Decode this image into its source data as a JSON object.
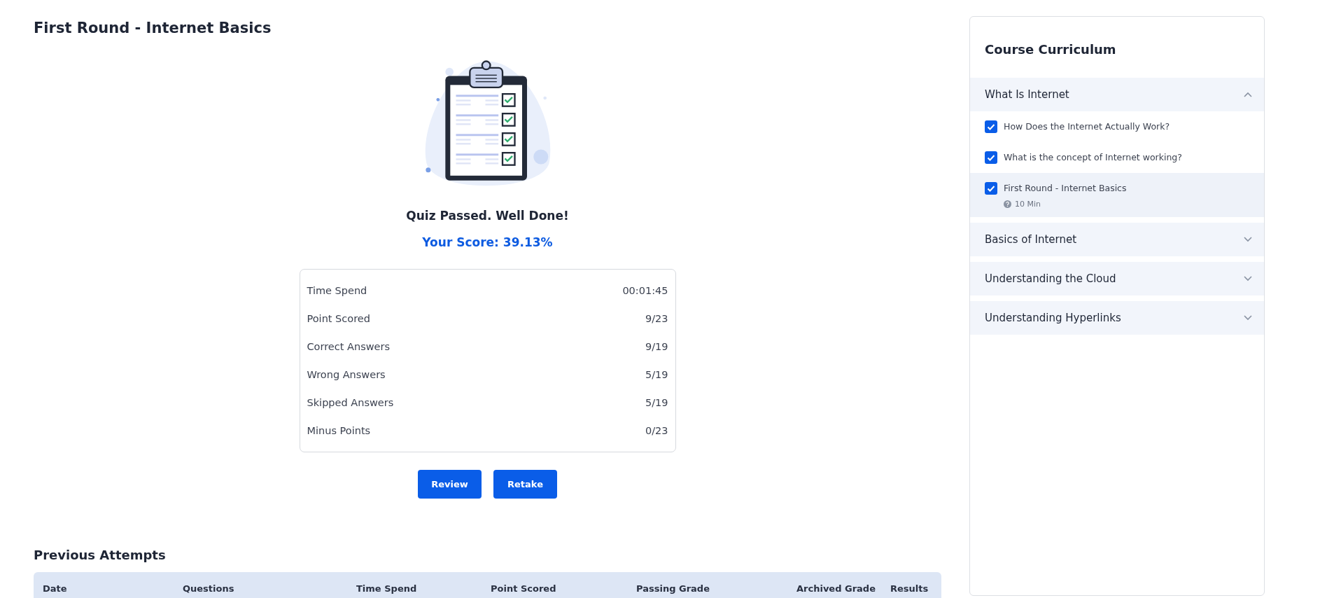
{
  "page_title": "First Round - Internet Basics",
  "result": {
    "message": "Quiz Passed. Well Done!",
    "score": "Your Score: 39.13%"
  },
  "stats": [
    {
      "label": "Time Spend",
      "value": "00:01:45"
    },
    {
      "label": "Point Scored",
      "value": "9/23"
    },
    {
      "label": "Correct Answers",
      "value": "9/19"
    },
    {
      "label": "Wrong Answers",
      "value": "5/19"
    },
    {
      "label": "Skipped Answers",
      "value": "5/19"
    },
    {
      "label": "Minus Points",
      "value": "0/23"
    }
  ],
  "buttons": [
    "Review",
    "Retake"
  ],
  "previous_attempts": {
    "title": "Previous Attempts",
    "columns": [
      "Date",
      "Questions",
      "Time Spend",
      "Point Scored",
      "Passing Grade",
      "Archived Grade",
      "Results"
    ]
  },
  "curriculum": {
    "title": "Course Curriculum",
    "sections": [
      {
        "title": "What Is Internet",
        "expanded": true,
        "lessons": [
          {
            "title": "How Does the Internet Actually Work?",
            "checked": true,
            "selected": false
          },
          {
            "title": "What is the concept of Internet working?",
            "checked": true,
            "selected": false
          },
          {
            "title": "First Round - Internet Basics",
            "checked": true,
            "selected": true,
            "duration": "10 Min"
          }
        ]
      },
      {
        "title": "Basics of Internet",
        "expanded": false
      },
      {
        "title": "Understanding the Cloud",
        "expanded": false
      },
      {
        "title": "Understanding Hyperlinks",
        "expanded": false
      }
    ]
  }
}
